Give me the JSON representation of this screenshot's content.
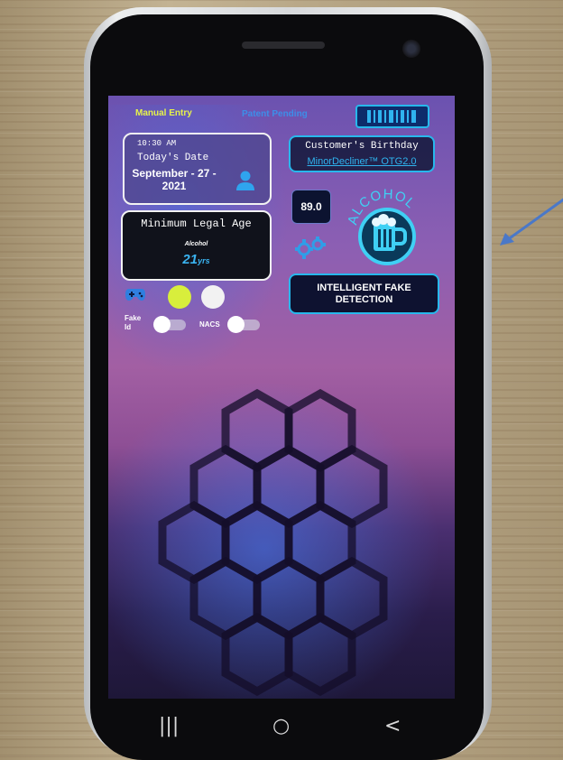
{
  "topbar": {
    "manual_entry_label": "Manual Entry",
    "pending_label": "Patent Pending",
    "barcode_icon": "barcode-icon"
  },
  "date_card": {
    "time": "10:30 AM",
    "label": "Today's Date",
    "date_line1": "September - 27 -",
    "date_line2": "2021",
    "icon": "person-icon"
  },
  "age_card": {
    "title": "Minimum Legal Age",
    "substance": "Alcohol",
    "age": "21",
    "unit": "yrs"
  },
  "birthday": {
    "title": "Customer's Birthday",
    "brand": "MinorDecliner™ OTG2.0"
  },
  "reading": {
    "value": "89.0"
  },
  "alcohol_badge": {
    "label": "ALCOHOL",
    "icon": "beer-mug-icon"
  },
  "fake_detection_button": {
    "line1": "INTELLIGENT FAKE",
    "line2": "DETECTION"
  },
  "toggles": {
    "fake_id_line1": "Fake",
    "fake_id_line2": "Id",
    "fake_id_on": false,
    "nacs_label": "NACS",
    "nacs_on": false
  },
  "indicators": {
    "yellow": "#d8ee3c",
    "white": "#f2f2f2"
  },
  "navbar": {
    "recents": "|||",
    "home": "○",
    "back": "<"
  },
  "colors": {
    "accent_cyan": "#27b8ec",
    "manual_entry": "#e6f24a"
  }
}
